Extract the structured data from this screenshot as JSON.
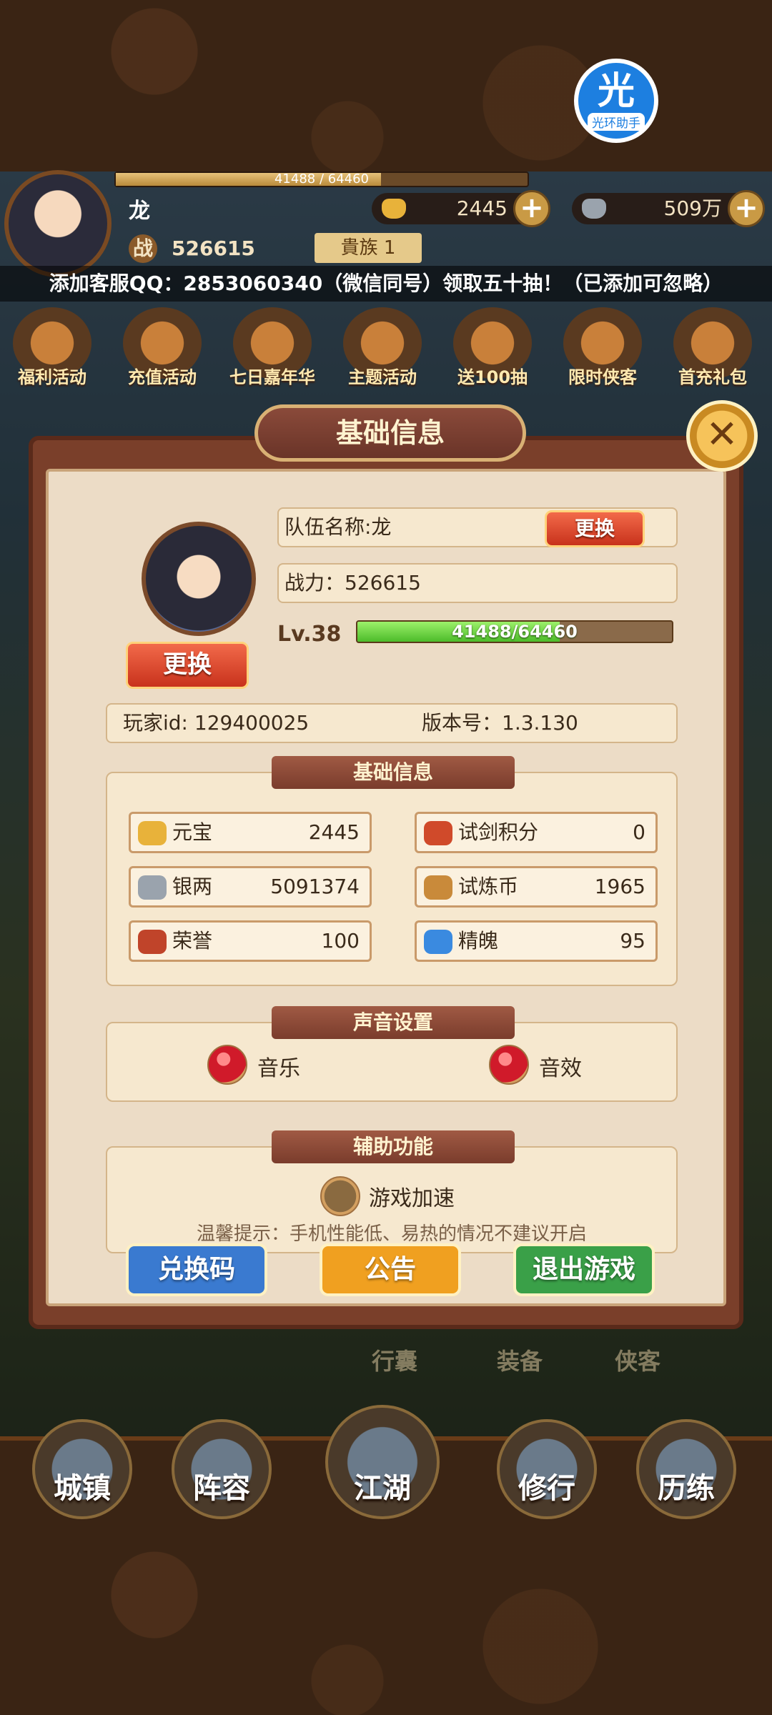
{
  "helper": {
    "glyph": "光",
    "label": "光环助手"
  },
  "status": {
    "exp_text": "41488 / 64460",
    "exp_fraction": 0.6436,
    "player_name": "龙",
    "gold": "2445",
    "silver": "509万",
    "power_label": "战",
    "power": "526615",
    "rank_tag": "貴族 1"
  },
  "notice": "添加客服QQ：2853060340（微信同号）领取五十抽！（已添加可忽略）",
  "activities": [
    {
      "label": "福利活动"
    },
    {
      "label": "充值活动"
    },
    {
      "label": "七日嘉年华"
    },
    {
      "label": "主题活动"
    },
    {
      "label": "送100抽"
    },
    {
      "label": "限时侠客"
    },
    {
      "label": "首充礼包"
    }
  ],
  "modal": {
    "title": "基础信息",
    "close_glyph": "✕",
    "team_name": "队伍名称:龙",
    "change_label": "更换",
    "avatar_change_label": "更换",
    "power_text": "战力：526615",
    "level": "Lv.38",
    "exp_text": "41488/64460",
    "exp_fraction": 0.6436,
    "player_id": "玩家id: 129400025",
    "version": "版本号：1.3.130",
    "basic_section_title": "基础信息",
    "resources": [
      {
        "name": "元宝",
        "value": "2445",
        "color": "#e8b23a"
      },
      {
        "name": "试剑积分",
        "value": "0",
        "color": "#d04a2a"
      },
      {
        "name": "银两",
        "value": "5091374",
        "color": "#9aa3ad"
      },
      {
        "name": "试炼币",
        "value": "1965",
        "color": "#c98a3a"
      },
      {
        "name": "荣誉",
        "value": "100",
        "color": "#c0442a"
      },
      {
        "name": "精魄",
        "value": "95",
        "color": "#3a8ae0"
      }
    ],
    "sound_section_title": "声音设置",
    "music_label": "音乐",
    "sfx_label": "音效",
    "assist_section_title": "辅助功能",
    "speed_label": "游戏加速",
    "tip": "温馨提示：手机性能低、易热的情况不建议开启",
    "redeem_label": "兑换码",
    "announce_label": "公告",
    "exit_label": "退出游戏"
  },
  "mid_tabs": [
    "行囊",
    "装备",
    "侠客"
  ],
  "bottom_nav": [
    {
      "label": "城镇"
    },
    {
      "label": "阵容"
    },
    {
      "label": "江湖"
    },
    {
      "label": "修行"
    },
    {
      "label": "历练"
    }
  ],
  "colors": {
    "redeem": "#3a7ad0",
    "announce": "#f0a020",
    "exit": "#3aa048",
    "exp_fill": "#4cbc2a"
  }
}
